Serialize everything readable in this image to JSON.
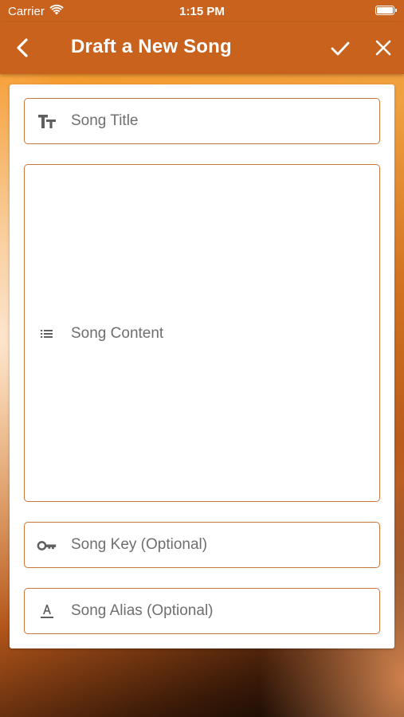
{
  "status_bar": {
    "carrier": "Carrier",
    "time": "1:15 PM",
    "icons": [
      "wifi-icon",
      "battery-icon"
    ]
  },
  "nav": {
    "title": "Draft a New Song",
    "icons": [
      "chevron-left-icon",
      "checkmark-icon",
      "close-icon"
    ]
  },
  "form": {
    "title_placeholder": "Song Title",
    "content_placeholder": "Song Content",
    "key_placeholder": "Song Key (Optional)",
    "alias_placeholder": "Song Alias (Optional)",
    "icons": [
      "text-size-icon",
      "list-icon",
      "key-icon",
      "text-format-icon"
    ]
  },
  "colors": {
    "bar": "#c9621c",
    "field_border": "#c9763a",
    "placeholder": "#6f6f6f",
    "icon": "#5f5f5f"
  }
}
